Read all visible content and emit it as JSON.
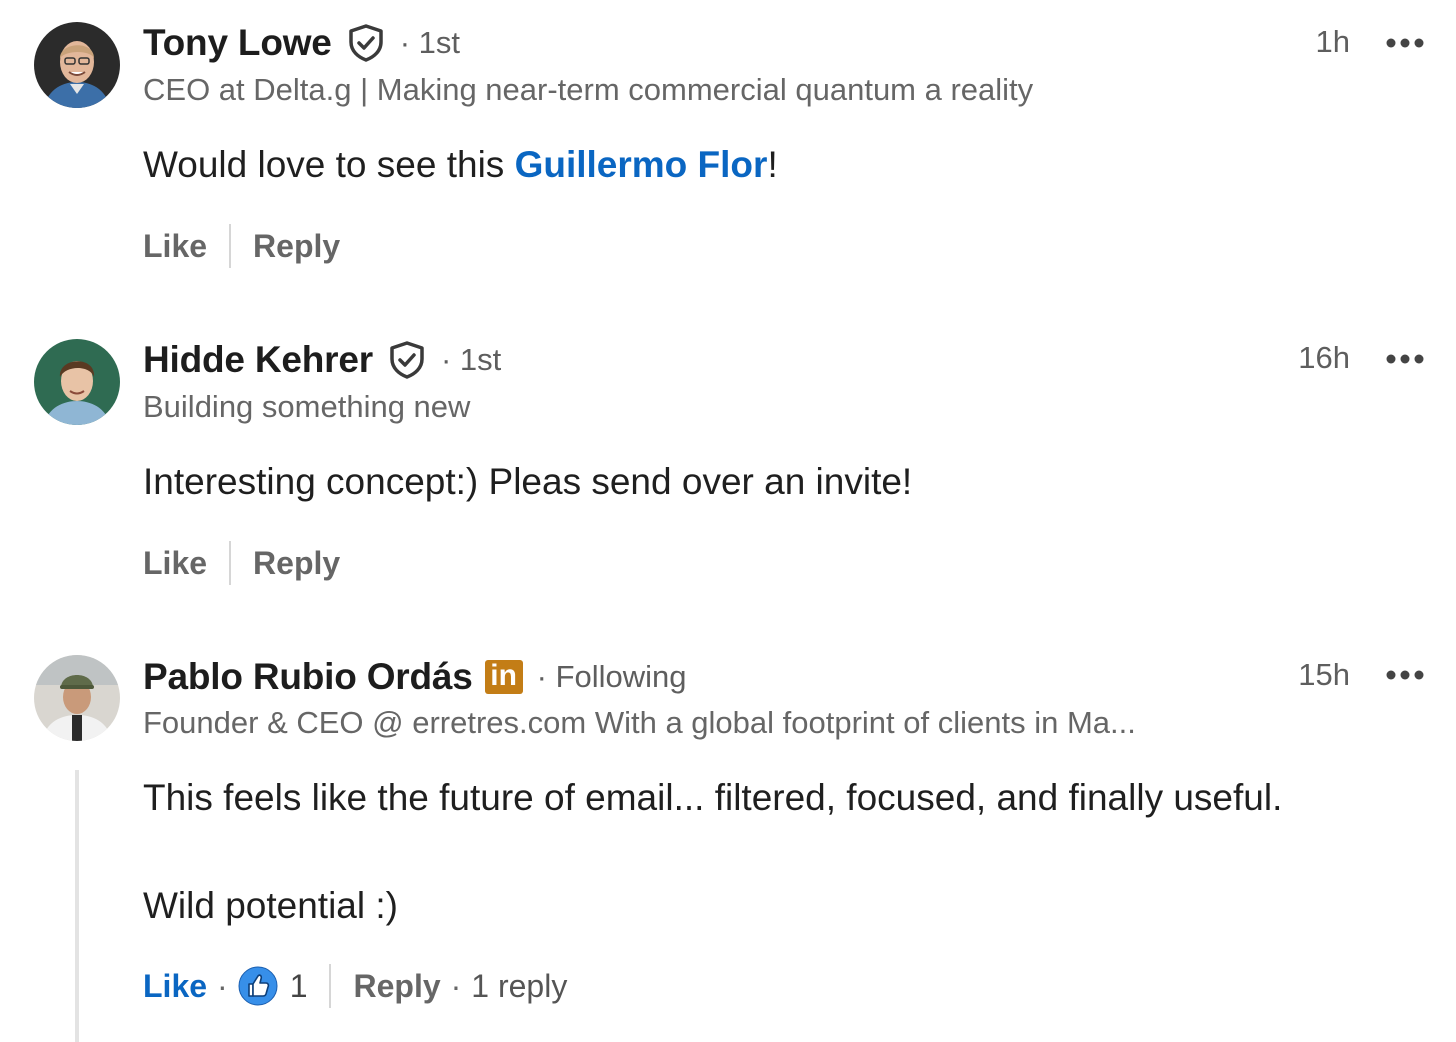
{
  "comments": [
    {
      "author": "Tony Lowe",
      "badge_icon": "verified-shield-icon",
      "connection": "· 1st",
      "headline": "CEO at Delta.g | Making near-term commercial quantum a reality",
      "time": "1h",
      "text_before": "Would love to see this ",
      "mention": "Guillermo Flor",
      "text_after": "!",
      "like_label": "Like",
      "reply_label": "Reply"
    },
    {
      "author": "Hidde Kehrer",
      "badge_icon": "verified-shield-icon",
      "connection": "· 1st",
      "headline": "Building something new",
      "time": "16h",
      "text": "Interesting concept:) Pleas send over an invite!",
      "like_label": "Like",
      "reply_label": "Reply"
    },
    {
      "author": "Pablo Rubio Ordás",
      "badge_icon": "linkedin-premium-icon",
      "badge_text": "in",
      "connection": "· Following",
      "headline": "Founder & CEO @ erretres.com With a global footprint of clients in Ma...",
      "time": "15h",
      "text_line1": "This feels like the future of email... filtered, focused, and finally useful.",
      "text_line2": "Wild potential :)",
      "like_label": "Like",
      "like_separator": "·",
      "reaction_icon": "thumbs-up-icon",
      "reaction_count": "1",
      "reply_label": "Reply",
      "reply_separator": "·",
      "reply_count": "1 reply"
    }
  ],
  "colors": {
    "link_blue": "#0a66c2",
    "premium_gold": "#c37d16",
    "muted_text": "#666666"
  }
}
